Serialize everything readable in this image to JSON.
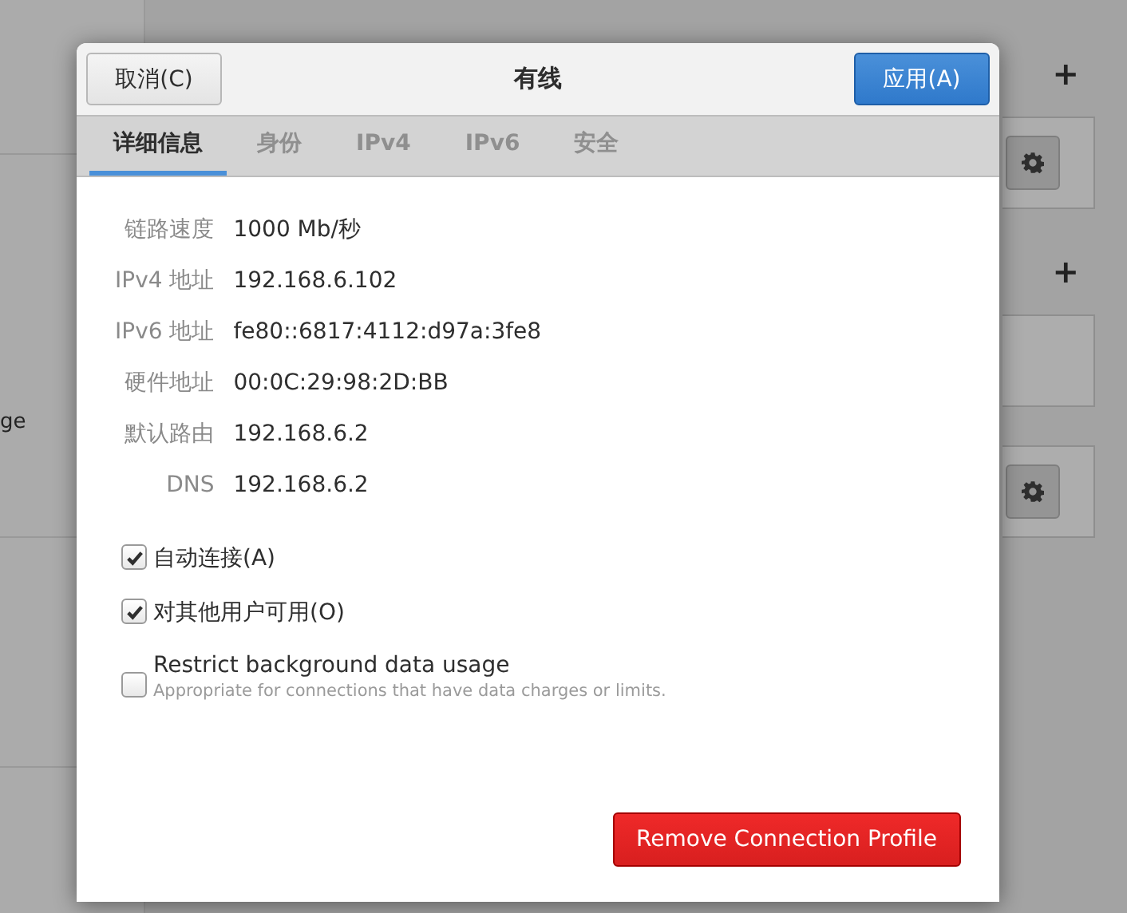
{
  "background": {
    "sidebar_fragment": "ge",
    "sections": [
      {
        "add": "+",
        "cards": [
          {
            "kind": "gear"
          }
        ]
      },
      {
        "add": "+",
        "cards": [
          {
            "kind": "empty"
          },
          {
            "kind": "gear"
          }
        ]
      }
    ]
  },
  "dialog": {
    "cancel": "取消(C)",
    "title": "有线",
    "apply": "应用(A)",
    "tabs": [
      {
        "label": "详细信息",
        "selected": true
      },
      {
        "label": "身份",
        "selected": false
      },
      {
        "label": "IPv4",
        "selected": false
      },
      {
        "label": "IPv6",
        "selected": false
      },
      {
        "label": "安全",
        "selected": false
      }
    ],
    "details": [
      {
        "label": "链路速度",
        "value": "1000 Mb/秒"
      },
      {
        "label": "IPv4 地址",
        "value": "192.168.6.102"
      },
      {
        "label": "IPv6 地址",
        "value": "fe80::6817:4112:d97a:3fe8"
      },
      {
        "label": "硬件地址",
        "value": "00:0C:29:98:2D:BB"
      },
      {
        "label": "默认路由",
        "value": "192.168.6.2"
      },
      {
        "label": "DNS",
        "value": "192.168.6.2"
      }
    ],
    "options": [
      {
        "label": "自动连接(A)",
        "checked": true
      },
      {
        "label": "对其他用户可用(O)",
        "checked": true
      },
      {
        "label": "Restrict background data usage",
        "checked": false,
        "description": "Appropriate for connections that have data charges or limits."
      }
    ],
    "remove": "Remove Connection Profile"
  }
}
